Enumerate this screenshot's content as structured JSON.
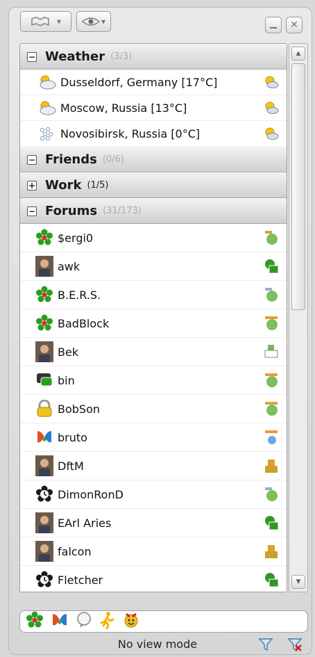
{
  "toolbar": {
    "status_menu": "status-menu",
    "view_menu": "view-menu",
    "minimize_icon": "minimize-icon",
    "close_icon": "close-icon"
  },
  "groups": {
    "weather": {
      "name": "Weather",
      "count": "(3/3)",
      "items": [
        {
          "label": "Dusseldorf, Germany  [17°C]",
          "icon": "cloudy-icon"
        },
        {
          "label": "Moscow, Russia  [13°C]",
          "icon": "cloudy-icon"
        },
        {
          "label": "Novosibirsk, Russia  [0°C]",
          "icon": "snow-icon"
        }
      ]
    },
    "friends": {
      "name": "Friends",
      "count": "(0/6)"
    },
    "work": {
      "name": "Work",
      "count": "(1/5)"
    },
    "forums": {
      "name": "Forums",
      "count": "(31/173)",
      "contacts": [
        {
          "name": "$ergi0",
          "icon": "icq-flower-icon"
        },
        {
          "name": "awk",
          "icon": "photo-avatar-icon"
        },
        {
          "name": "B.E.R.S.",
          "icon": "icq-flower-icon"
        },
        {
          "name": "BadBlock",
          "icon": "icq-flower-icon"
        },
        {
          "name": "Bek",
          "icon": "photo-avatar-icon"
        },
        {
          "name": "bin",
          "icon": "chat-icon"
        },
        {
          "name": "BobSon",
          "icon": "lock-icon"
        },
        {
          "name": "bruto",
          "icon": "msn-butterfly-icon"
        },
        {
          "name": "DftM",
          "icon": "photo-avatar-icon"
        },
        {
          "name": "DimonRonD",
          "icon": "clock-status-icon"
        },
        {
          "name": "EArl Aries",
          "icon": "photo-avatar-icon"
        },
        {
          "name": "falcon",
          "icon": "photo-avatar-icon"
        },
        {
          "name": "Fletcher",
          "icon": "clock-status-icon"
        }
      ]
    }
  },
  "status": {
    "mode_text": "No view mode",
    "protocols": [
      "icq-icon",
      "msn-icon",
      "jabber-icon",
      "aim-icon",
      "gg-icon"
    ]
  },
  "colors": {
    "icq_green": "#2f9a22",
    "icq_red": "#d0322a",
    "panel": "#d8d8d8"
  }
}
